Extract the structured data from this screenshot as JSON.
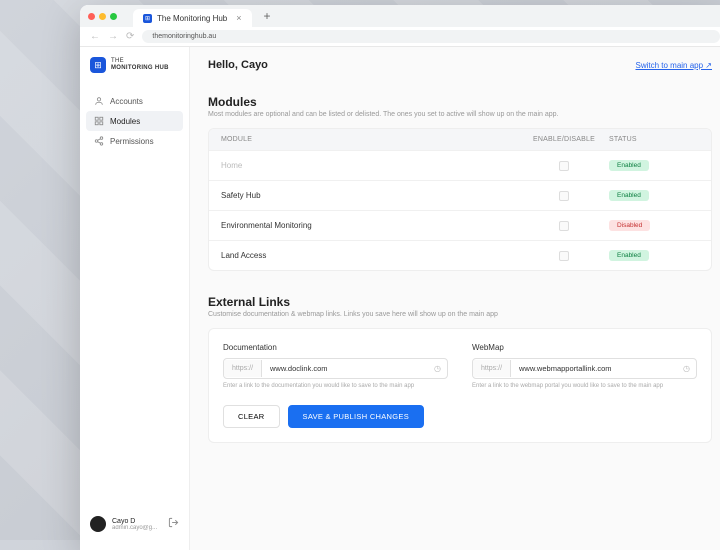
{
  "browser": {
    "tab_title": "The Monitoring Hub",
    "url": "themonitoringhub.au"
  },
  "brand": {
    "line1": "THE",
    "line2": "MONITORING HUB"
  },
  "sidebar": {
    "items": [
      {
        "label": "Accounts"
      },
      {
        "label": "Modules"
      },
      {
        "label": "Permissions"
      }
    ]
  },
  "user": {
    "name": "Cayo D",
    "email": "admin.cayo@g..."
  },
  "header": {
    "greeting": "Hello, Cayo",
    "switch": "Switch to main app  ↗"
  },
  "modules": {
    "title": "Modules",
    "subtitle": "Most modules are optional and can be listed or delisted. The ones you set to active will show up on the main app.",
    "columns": {
      "module": "MODULE",
      "enable": "ENABLE/DISABLE",
      "status": "STATUS"
    },
    "rows": [
      {
        "name": "Home",
        "status": "Enabled",
        "status_type": "en",
        "dim": true
      },
      {
        "name": "Safety Hub",
        "status": "Enabled",
        "status_type": "en"
      },
      {
        "name": "Environmental Monitoring",
        "status": "Disabled",
        "status_type": "dis"
      },
      {
        "name": "Land Access",
        "status": "Enabled",
        "status_type": "en"
      }
    ]
  },
  "external": {
    "title": "External Links",
    "subtitle": "Customise documentation & webmap links. Links you save here will show up on the main app",
    "doc": {
      "label": "Documentation",
      "proto": "https://",
      "value": "www.doclink.com",
      "helper": "Enter a link to the documentation you would like to save to the main app"
    },
    "webmap": {
      "label": "WebMap",
      "proto": "https://",
      "value": "www.webmapportallink.com",
      "helper": "Enter a link to the webmap portal you would like to save to the main app"
    },
    "buttons": {
      "clear": "CLEAR",
      "save": "SAVE & PUBLISH CHANGES"
    }
  }
}
